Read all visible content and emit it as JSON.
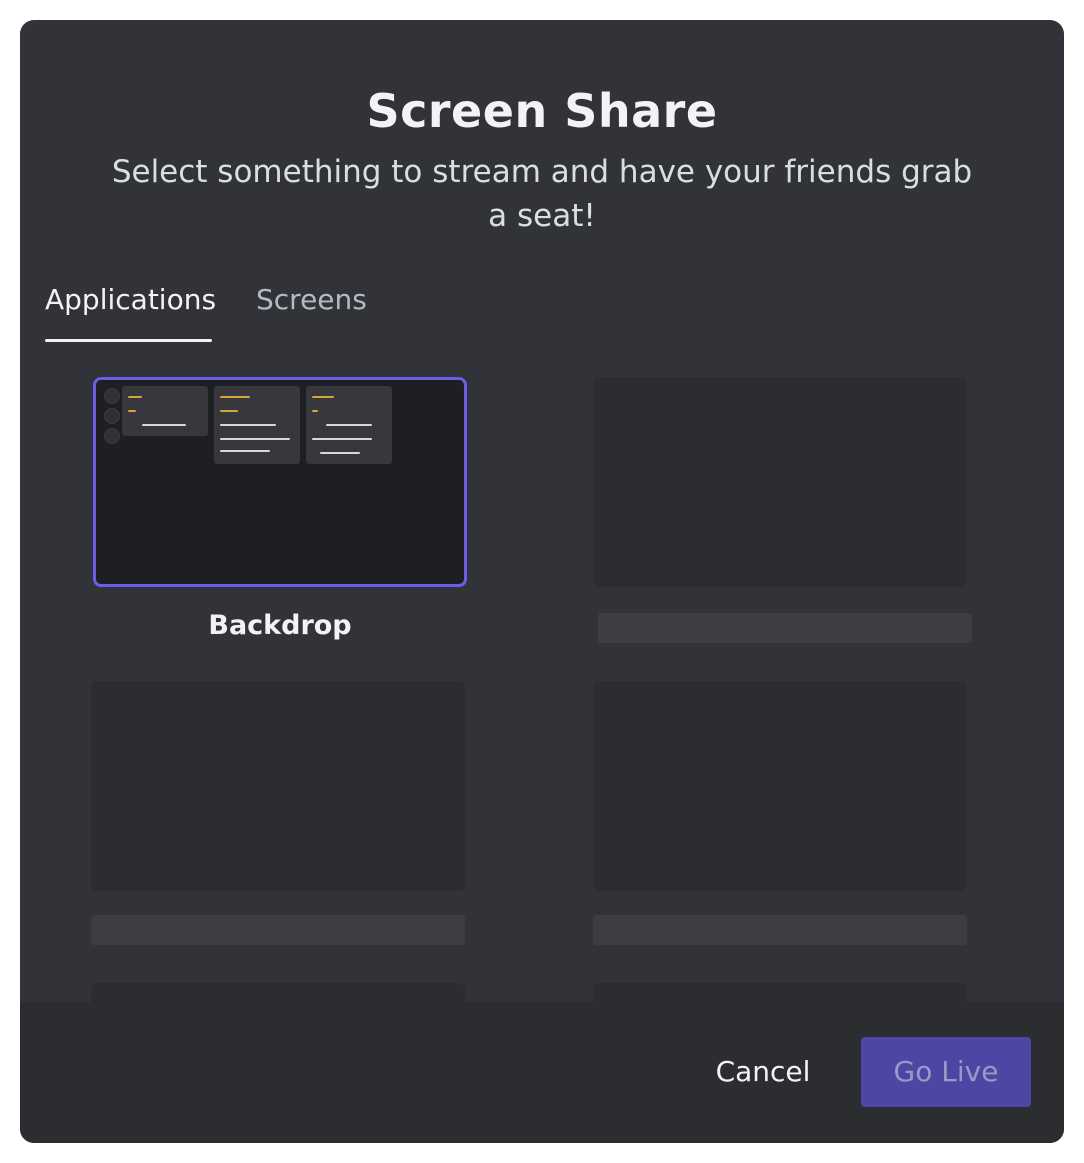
{
  "modal": {
    "title": "Screen Share",
    "subtitle": "Select something to stream and have your friends grab a seat!"
  },
  "tabs": [
    {
      "label": "Applications",
      "active": true
    },
    {
      "label": "Screens",
      "active": false
    }
  ],
  "applications": [
    {
      "label": "Backdrop",
      "selected": true
    }
  ],
  "footer": {
    "cancel_label": "Cancel",
    "go_live_label": "Go Live"
  },
  "colors": {
    "modal_bg": "#313338",
    "footer_bg": "#2b2d31",
    "selection_border": "#6d5ce8",
    "go_live_bg": "#4e46a3"
  }
}
